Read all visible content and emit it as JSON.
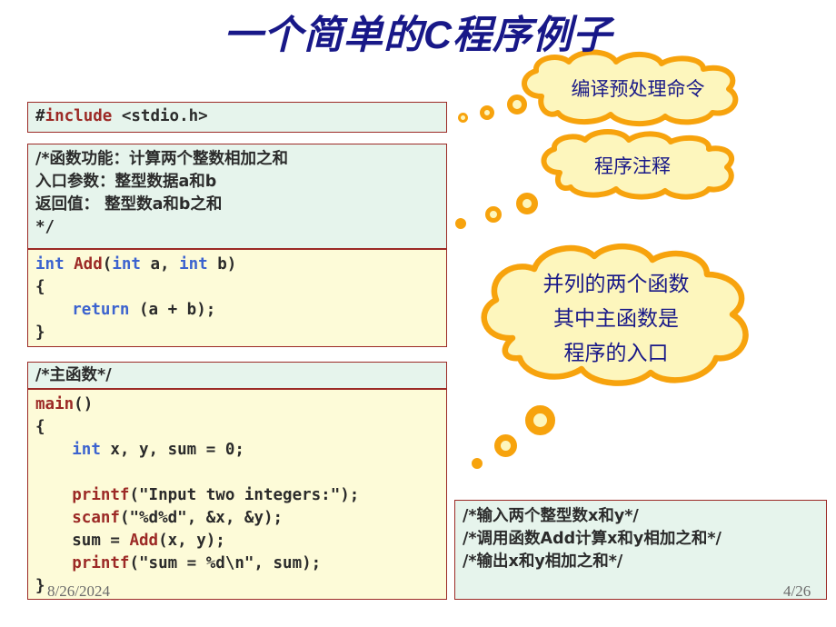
{
  "slide": {
    "title": "一个简单的C程序例子",
    "date": "8/26/2024",
    "page_number": "4/26",
    "accent_orange": "#f7a30d",
    "cloud_fill": "#fdf6bd",
    "title_color": "#181888",
    "code_bg": "#fdfbd8",
    "comment_bg": "#e6f4ec",
    "box_border": "#9c2a26",
    "keyword_color": "#3c63cf",
    "function_color": "#9c2a26"
  },
  "code": {
    "include": {
      "hash": "#",
      "directive": "include",
      "header": " <stdio.h>"
    },
    "func_doc": {
      "l1": "/*函数功能：计算两个整数相加之和",
      "l2": "  入口参数：整型数据a和b",
      "l3": "  返回值：   整型数a和b之和",
      "l4": "*/"
    },
    "add_func": {
      "sig_kw1": "int",
      "sig_name": " Add",
      "sig_rest1": "(",
      "sig_kw2": "int",
      "sig_rest2": " a, ",
      "sig_kw3": "int",
      "sig_rest3": " b)",
      "open_brace": "{",
      "return_kw": "return",
      "return_expr": " (a + b);",
      "close_brace": "}"
    },
    "main_doc": "/*主函数*/",
    "main_func": {
      "name": "main",
      "name_rest": "()",
      "open_brace": "{",
      "decl_kw": "int",
      "decl_rest": "  x, y, sum = 0;",
      "blank": "",
      "printf1_fn": "printf",
      "printf1_rest": "(\"Input two integers:\");",
      "scanf_fn": "scanf",
      "scanf_rest": "(\"%d%d\", &x, &y);",
      "sum_pre": "sum = ",
      "sum_fn": "Add",
      "sum_rest": "(x, y);",
      "printf2_fn": "printf",
      "printf2_rest": "(\"sum = %d\\n\", sum);",
      "close_brace": "}"
    },
    "side_doc": {
      "l1": "/*输入两个整型数x和y*/",
      "l2": "/*调用函数Add计算x和y相加之和*/",
      "l3": "/*输出x和y相加之和*/"
    }
  },
  "callouts": {
    "preprocess": {
      "line1": "编译预处理命令"
    },
    "comment": {
      "line1": "程序注释"
    },
    "functions": {
      "line1": "并列的两个函数",
      "line2": "其中主函数是",
      "line3": "程序的入口"
    }
  }
}
